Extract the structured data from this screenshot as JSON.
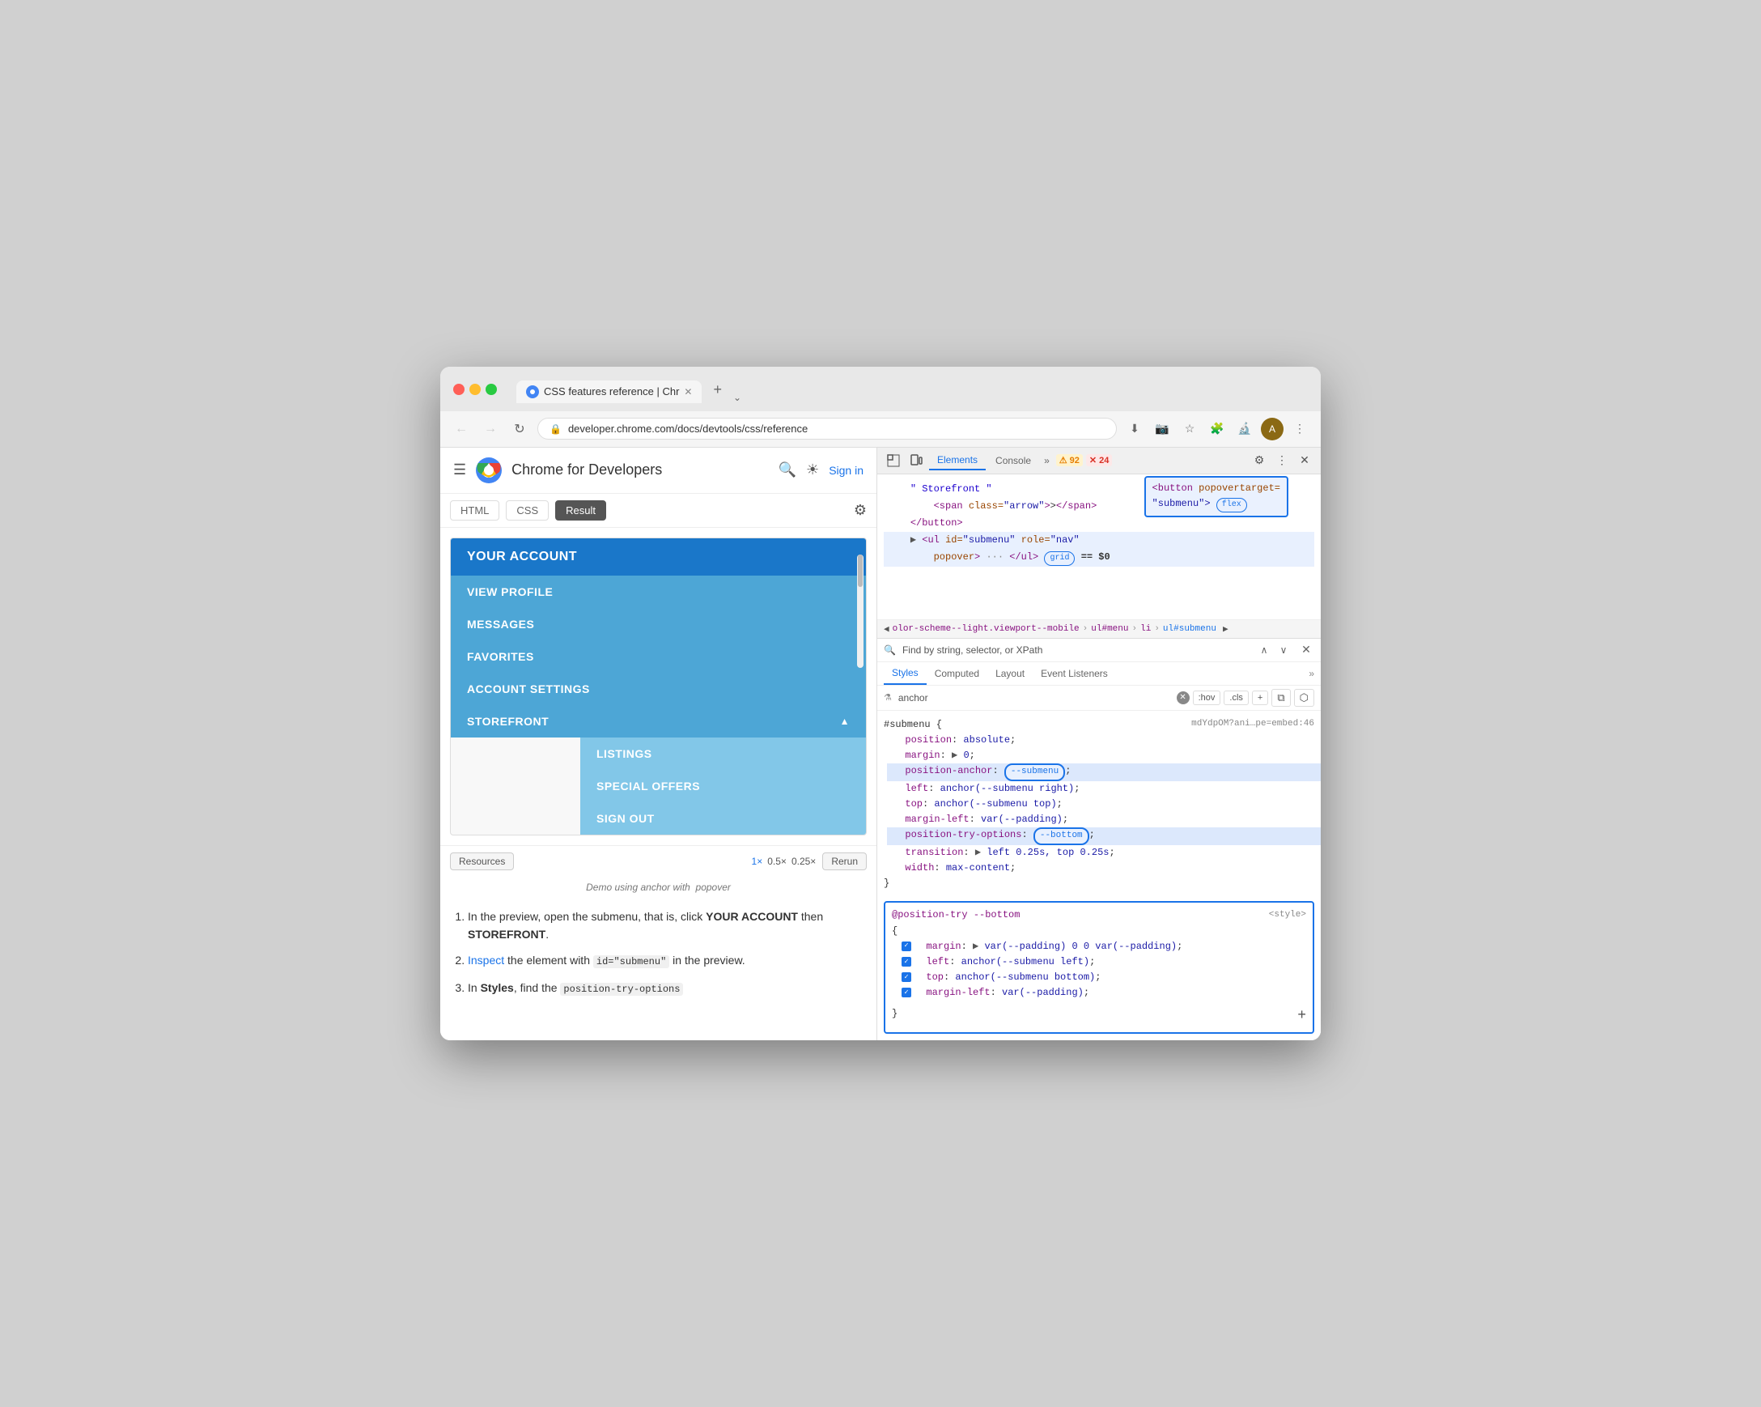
{
  "window": {
    "title": "CSS features reference | Chr",
    "tab_title": "CSS features reference | Chr",
    "url": "developer.chrome.com/docs/devtools/css/reference"
  },
  "site_header": {
    "site_name": "Chrome for Developers",
    "sign_in": "Sign in"
  },
  "code_tabs": {
    "tabs": [
      "HTML",
      "CSS",
      "Result"
    ],
    "active": "Result"
  },
  "demo": {
    "menu_title": "YOUR ACCOUNT",
    "menu_items": [
      "VIEW PROFILE",
      "MESSAGES",
      "FAVORITES",
      "ACCOUNT SETTINGS"
    ],
    "storefront_label": "STOREFRONT",
    "storefront_arrow": "▲",
    "submenu_items": [
      "LISTINGS",
      "SPECIAL OFFERS",
      "SIGN OUT"
    ],
    "controls": {
      "resources": "Resources",
      "zoom_1x": "1×",
      "zoom_0_5x": "0.5×",
      "zoom_0_25x": "0.25×",
      "rerun": "Rerun"
    },
    "caption": "Demo using anchor with  popover"
  },
  "article": {
    "steps": [
      {
        "number": "1",
        "text_parts": [
          "In the preview, open the submenu, that is, click ",
          "YOUR ACCOUNT",
          " then ",
          "STOREFRONT",
          "."
        ]
      },
      {
        "number": "2",
        "text_parts": [
          "Inspect",
          " the element with ",
          "id=\"submenu\"",
          " in the preview."
        ]
      },
      {
        "number": "3",
        "text_parts": [
          "In ",
          "Styles",
          ", find the ",
          "position-try-options"
        ]
      }
    ]
  },
  "devtools": {
    "toolbar": {
      "tabs": [
        "Elements",
        "Console",
        "»"
      ],
      "active_tab": "Elements",
      "badge_warning": "⚠ 92",
      "badge_error": "✕ 24"
    },
    "html_view": {
      "annotation": {
        "line1": "<button popovertarget=",
        "line2": "\"submenu\"> flex"
      },
      "lines": [
        {
          "indent": 0,
          "content": "\" Storefront \"",
          "type": "string"
        },
        {
          "indent": 1,
          "content": "<span class=\"arrow\">></span>",
          "type": "mixed"
        },
        {
          "indent": 0,
          "content": "</button>",
          "type": "tag"
        },
        {
          "indent": 0,
          "content": "▶ <ul id=\"submenu\" role=\"nav\"",
          "type": "mixed"
        },
        {
          "indent": 1,
          "content": "popover> ··· </ul>",
          "type": "mixed",
          "badge": "grid",
          "dollar": "$0"
        }
      ]
    },
    "breadcrumb": {
      "items": [
        "◀ olor-scheme--light.viewport--mobile",
        "ul#menu",
        "li",
        "ul#submenu"
      ]
    },
    "search": {
      "placeholder": "Find by string, selector, or XPath"
    },
    "styles_tabs": [
      "Styles",
      "Computed",
      "Layout",
      "Event Listeners",
      "»"
    ],
    "active_styles_tab": "Styles",
    "filter": {
      "placeholder": "anchor",
      "actions": [
        ":hov",
        ".cls",
        "+"
      ]
    },
    "css_rules": {
      "submenu_selector": "#submenu {",
      "source": "mdYdpOM?ani…pe=embed:46",
      "properties": [
        {
          "prop": "position",
          "value": "absolute",
          "checked": false
        },
        {
          "prop": "margin",
          "value": "▶ 0",
          "checked": false
        },
        {
          "prop": "position-anchor",
          "value": "--submenu",
          "checked": false,
          "highlighted": true
        },
        {
          "prop": "left",
          "value": "anchor(--submenu right)",
          "checked": false
        },
        {
          "prop": "top",
          "value": "anchor(--submenu top)",
          "checked": false
        },
        {
          "prop": "margin-left",
          "value": "var(--padding)",
          "checked": false
        },
        {
          "prop": "position-try-options",
          "value": "--bottom",
          "checked": false,
          "highlighted": true
        },
        {
          "prop": "transition",
          "value": "▶ left 0.25s, top 0.25s",
          "checked": false
        },
        {
          "prop": "width",
          "value": "max-content",
          "checked": false
        }
      ]
    },
    "position_try": {
      "selector": "@position-try --bottom",
      "source": "<style>",
      "properties": [
        {
          "prop": "margin",
          "value": "▶ var(--padding) 0 0 var(--padding)"
        },
        {
          "prop": "left",
          "value": "anchor(--submenu left)"
        },
        {
          "prop": "top",
          "value": "anchor(--submenu bottom)"
        },
        {
          "prop": "margin-left",
          "value": "var(--padding)"
        }
      ]
    }
  },
  "colors": {
    "chrome_blue": "#1a73e8",
    "menu_dark": "#1a77c9",
    "menu_medium": "#4da6d6",
    "menu_light": "#82c7e8",
    "annotation_blue": "#1558d6",
    "devtools_highlight": "#e8f0fe"
  }
}
